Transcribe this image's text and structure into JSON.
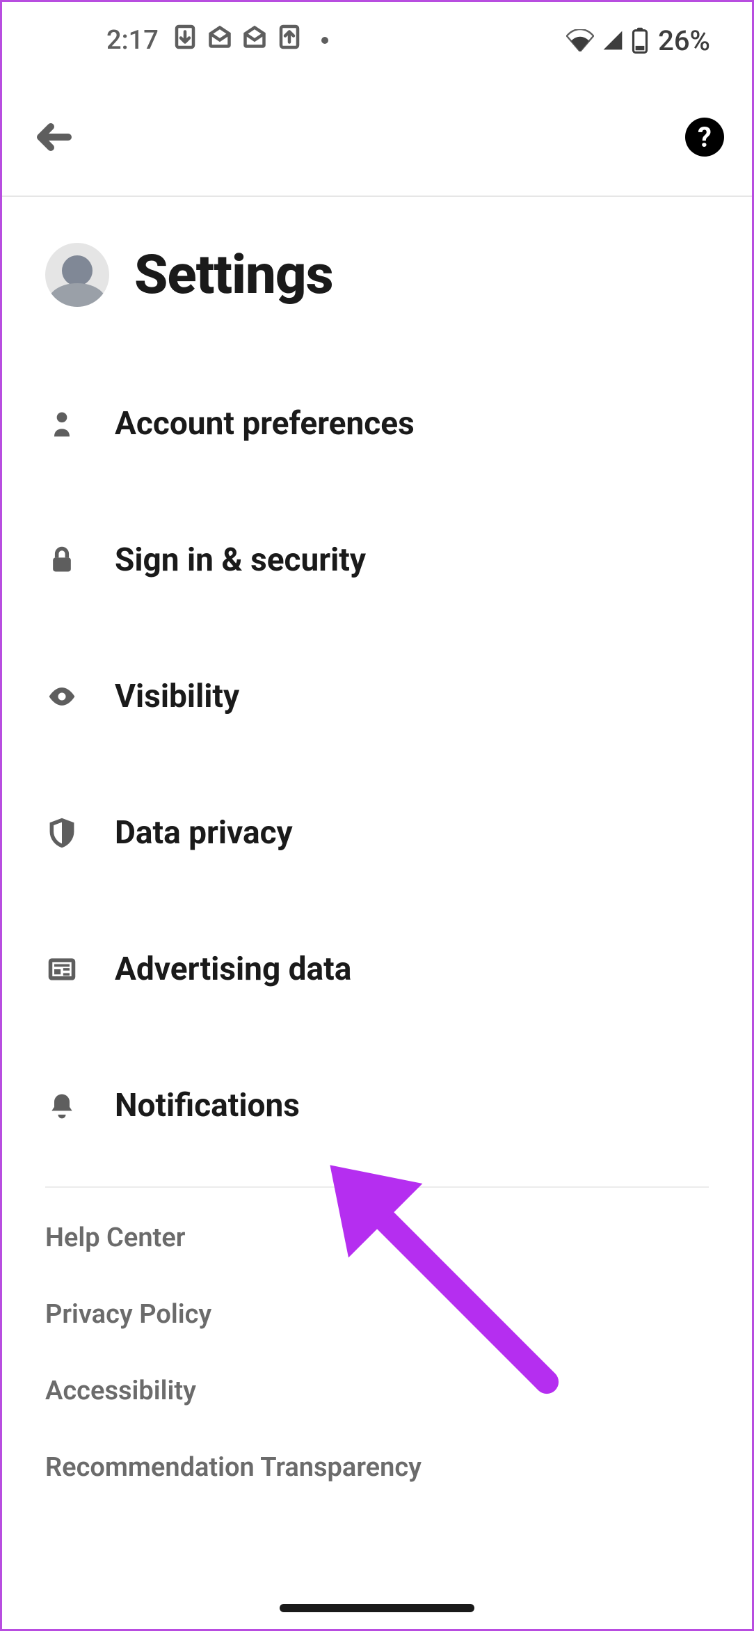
{
  "status_bar": {
    "time": "2:17",
    "battery_pct": "26%"
  },
  "header": {
    "title": "Settings"
  },
  "settings_items": [
    {
      "id": "account-preferences",
      "label": "Account preferences",
      "icon": "person-icon"
    },
    {
      "id": "sign-in-security",
      "label": "Sign in & security",
      "icon": "lock-icon"
    },
    {
      "id": "visibility",
      "label": "Visibility",
      "icon": "eye-icon"
    },
    {
      "id": "data-privacy",
      "label": "Data privacy",
      "icon": "shield-icon"
    },
    {
      "id": "advertising-data",
      "label": "Advertising data",
      "icon": "newspaper-icon"
    },
    {
      "id": "notifications",
      "label": "Notifications",
      "icon": "bell-icon"
    }
  ],
  "footer_links": [
    {
      "id": "help-center",
      "label": "Help Center"
    },
    {
      "id": "privacy-policy",
      "label": "Privacy Policy"
    },
    {
      "id": "accessibility",
      "label": "Accessibility"
    },
    {
      "id": "recommendation-transparency",
      "label": "Recommendation Transparency"
    }
  ],
  "annotation": {
    "target": "notifications",
    "color": "#b52ef0"
  }
}
